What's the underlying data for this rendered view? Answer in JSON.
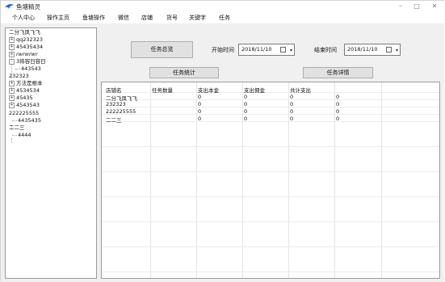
{
  "window": {
    "title": "鱼塘精灵",
    "minimize": "–",
    "maximize": "□",
    "close": "✕"
  },
  "menu": [
    "个人中心",
    "操作主页",
    "鱼塘操作",
    "微信",
    "店铺",
    "货号",
    "关键字",
    "任务"
  ],
  "tree": [
    {
      "label": "二分飞凤飞飞",
      "expander": "",
      "indent": 0
    },
    {
      "label": "qq232323",
      "expander": "+",
      "indent": 1
    },
    {
      "label": "45435434",
      "expander": "+",
      "indent": 1
    },
    {
      "label": "rwrwrwr",
      "expander": "+",
      "indent": 1
    },
    {
      "label": "3将容日容日",
      "expander": "-",
      "indent": 1
    },
    {
      "label": "443543",
      "expander": "",
      "indent": 2
    },
    {
      "label": "232323",
      "expander": "",
      "indent": 0
    },
    {
      "label": "方法是根本",
      "expander": "+",
      "indent": 1
    },
    {
      "label": "4534534",
      "expander": "+",
      "indent": 1
    },
    {
      "label": "45435",
      "expander": "+",
      "indent": 1
    },
    {
      "label": "4543543",
      "expander": "+",
      "indent": 1
    },
    {
      "label": "222225555",
      "expander": "",
      "indent": 0
    },
    {
      "label": "4435435",
      "expander": "",
      "indent": 1
    },
    {
      "label": "二二三",
      "expander": "",
      "indent": 0
    },
    {
      "label": "4444",
      "expander": "",
      "indent": 1
    }
  ],
  "toolbar": {
    "overview_button": "任务总览",
    "start_label": "开始时间",
    "start_date": "2018/11/10",
    "end_label": "结束时间",
    "end_date": "2018/11/10",
    "stats_button": "任务统计",
    "detail_button": "任务详情"
  },
  "table": {
    "headers": [
      "店铺名",
      "任务数量",
      "支出本金",
      "支出佣金",
      "共计支出"
    ],
    "rows": [
      [
        "二分飞凤飞飞",
        "0",
        "0",
        "0",
        "0"
      ],
      [
        "232323",
        "0",
        "0",
        "0",
        "0"
      ],
      [
        "222225555",
        "0",
        "0",
        "0",
        "0"
      ],
      [
        "二二三",
        "0",
        "0",
        "0",
        "0"
      ]
    ]
  }
}
